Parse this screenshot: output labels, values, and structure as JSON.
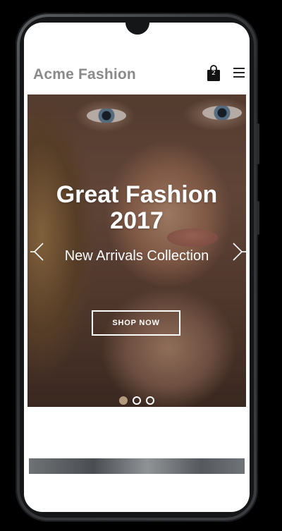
{
  "header": {
    "brand": "Acme Fashion",
    "cart_count": "2",
    "cart_icon": "shopping-bag-icon",
    "menu_icon": "hamburger-menu-icon"
  },
  "hero": {
    "title_line1": "Great Fashion",
    "title_line2": "2017",
    "subtitle": "New Arrivals Collection",
    "button_label": "SHOP NOW",
    "prev_icon": "chevron-left-icon",
    "next_icon": "chevron-right-icon",
    "slide_count": 3,
    "active_slide": 1
  },
  "colors": {
    "brand_text": "#8a8a8a",
    "active_dot": "#b49a7c"
  }
}
